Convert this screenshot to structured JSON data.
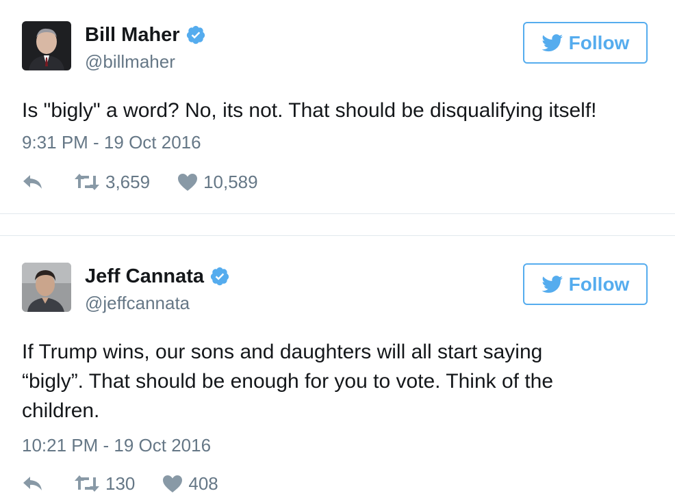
{
  "tweets": [
    {
      "display_name": "Bill Maher",
      "handle": "@billmaher",
      "verified": true,
      "follow_label": "Follow",
      "text": "Is \"bigly\" a word? No, its not. That should be disqualifying itself!",
      "timestamp": "9:31 PM - 19 Oct 2016",
      "retweets": "3,659",
      "likes": "10,589",
      "avatar_icon": "avatar-photo"
    },
    {
      "display_name": "Jeff Cannata",
      "handle": "@jeffcannata",
      "verified": true,
      "follow_label": "Follow",
      "text": "If Trump wins, our sons and daughters will all start saying\n“bigly”. That should be enough for you to vote. Think of the\nchildren.",
      "timestamp": "10:21 PM - 19 Oct 2016",
      "retweets": "130",
      "likes": "408",
      "avatar_icon": "avatar-photo"
    }
  ],
  "icons": {
    "verified": "verified-badge-icon",
    "bird": "twitter-bird-icon",
    "reply": "reply-icon",
    "retweet": "retweet-icon",
    "like": "heart-icon"
  },
  "colors": {
    "accent": "#55acee",
    "muted_text": "#657786",
    "action_icon": "#8899a6",
    "primary_text": "#14171a",
    "divider": "#e1e8ed"
  }
}
